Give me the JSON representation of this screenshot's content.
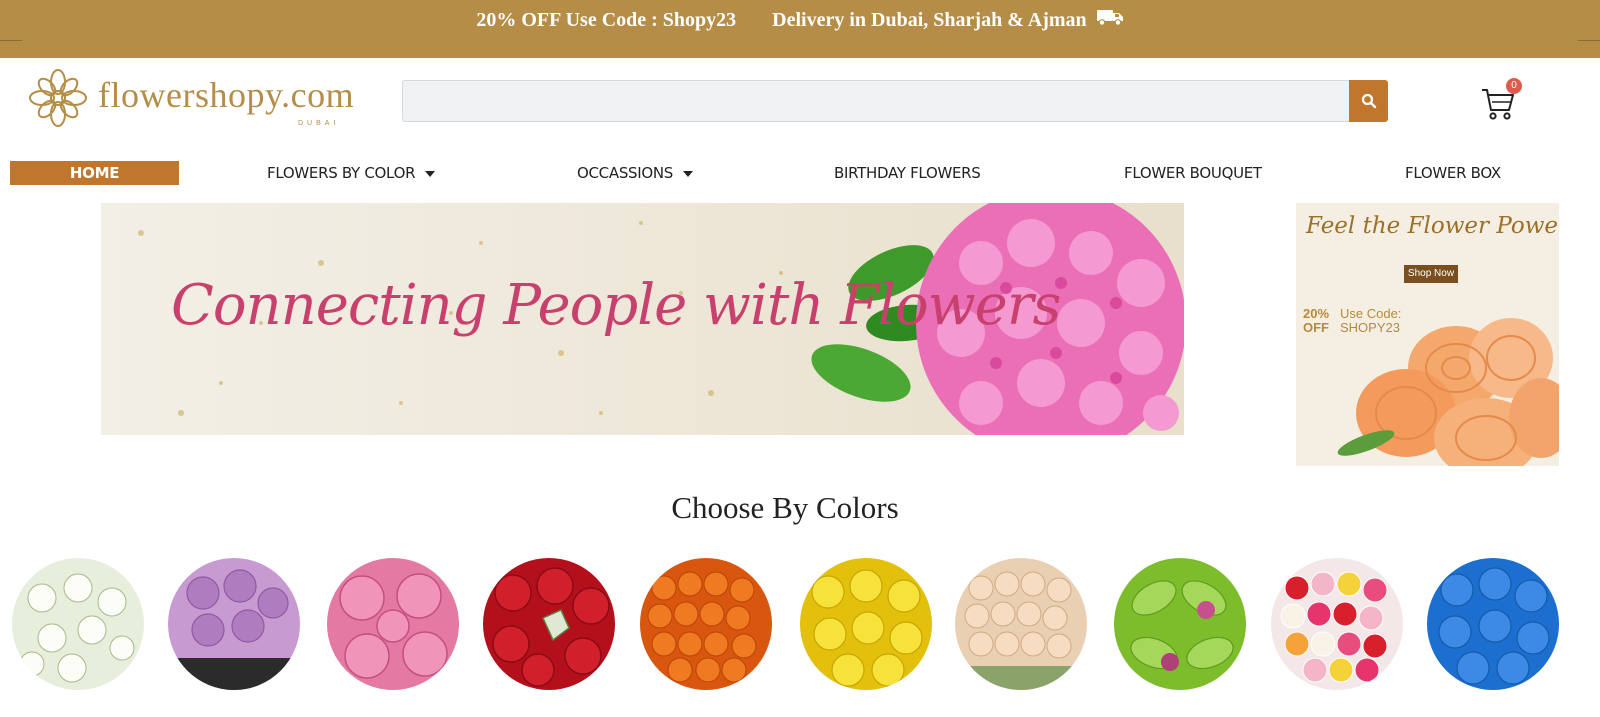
{
  "promo": {
    "offer": "20% OFF Use Code : Shopy23",
    "delivery": "Delivery in Dubai, Sharjah & Ajman",
    "background": "#b58d47"
  },
  "logo": {
    "text": "flowershopy.com",
    "subtext": "DUBAI"
  },
  "search": {
    "placeholder": "",
    "button_icon": "search-icon",
    "button_color": "#c0772d"
  },
  "cart": {
    "icon": "cart-icon",
    "count": "0"
  },
  "nav": {
    "items": [
      {
        "label": "HOME",
        "active": true
      },
      {
        "label": "FLOWERS BY COLOR",
        "dropdown": true
      },
      {
        "label": "OCCASSIONS",
        "dropdown": true
      },
      {
        "label": "BIRTHDAY FLOWERS"
      },
      {
        "label": "FLOWER BOUQUET"
      },
      {
        "label": "FLOWER BOX"
      }
    ]
  },
  "hero": {
    "title": "Connecting People with Flowers",
    "accent": "#c8416e"
  },
  "side_banner": {
    "title": "Feel the Flower Power",
    "button": "Shop Now",
    "discount": "20% OFF",
    "code_label": "Use Code:",
    "code": "SHOPY23"
  },
  "colors_section": {
    "title": "Choose By Colors",
    "swatches": [
      "#e8eedc",
      "#b98bc6",
      "#e780a6",
      "#c2141f",
      "#e86a16",
      "#f1d517",
      "#f2d2b2",
      "#8fcc3b",
      "#e0475e",
      "#2f7fd8"
    ]
  }
}
